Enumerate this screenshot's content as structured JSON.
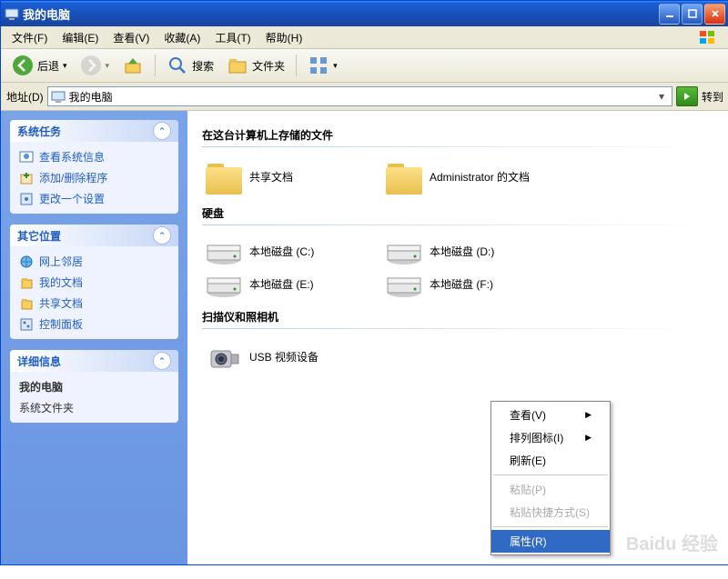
{
  "titlebar": {
    "title": "我的电脑"
  },
  "menubar": {
    "items": [
      {
        "label": "文件(F)"
      },
      {
        "label": "编辑(E)"
      },
      {
        "label": "查看(V)"
      },
      {
        "label": "收藏(A)"
      },
      {
        "label": "工具(T)"
      },
      {
        "label": "帮助(H)"
      }
    ]
  },
  "toolbar": {
    "back": "后退",
    "search": "搜索",
    "folders": "文件夹"
  },
  "addressbar": {
    "label": "地址(D)",
    "value": "我的电脑",
    "go": "转到"
  },
  "sidebar": {
    "panels": [
      {
        "title": "系统任务",
        "items": [
          {
            "label": "查看系统信息",
            "icon": "info"
          },
          {
            "label": "添加/删除程序",
            "icon": "addremove"
          },
          {
            "label": "更改一个设置",
            "icon": "settings"
          }
        ]
      },
      {
        "title": "其它位置",
        "items": [
          {
            "label": "网上邻居",
            "icon": "network"
          },
          {
            "label": "我的文档",
            "icon": "docs"
          },
          {
            "label": "共享文档",
            "icon": "shared"
          },
          {
            "label": "控制面板",
            "icon": "control"
          }
        ]
      },
      {
        "title": "详细信息",
        "static": [
          {
            "text": "我的电脑",
            "bold": true
          },
          {
            "text": "系统文件夹"
          }
        ]
      }
    ]
  },
  "content": {
    "sections": [
      {
        "title": "在这台计算机上存储的文件",
        "tiles": [
          {
            "label": "共享文档",
            "type": "folder"
          },
          {
            "label": "Administrator 的文档",
            "type": "folder"
          }
        ]
      },
      {
        "title": "硬盘",
        "tiles": [
          {
            "label": "本地磁盘 (C:)",
            "type": "drive"
          },
          {
            "label": "本地磁盘 (D:)",
            "type": "drive"
          },
          {
            "label": "本地磁盘 (E:)",
            "type": "drive"
          },
          {
            "label": "本地磁盘 (F:)",
            "type": "drive"
          }
        ]
      },
      {
        "title": "扫描仪和照相机",
        "tiles": [
          {
            "label": "USB 视频设备",
            "type": "camera"
          }
        ]
      }
    ]
  },
  "context_menu": {
    "items": [
      {
        "label": "查看(V)",
        "submenu": true
      },
      {
        "label": "排列图标(I)",
        "submenu": true
      },
      {
        "label": "刷新(E)"
      },
      {
        "sep": true
      },
      {
        "label": "粘贴(P)",
        "disabled": true
      },
      {
        "label": "粘贴快捷方式(S)",
        "disabled": true
      },
      {
        "sep": true
      },
      {
        "label": "属性(R)",
        "selected": true
      }
    ]
  },
  "watermark": "Baidu 经验"
}
